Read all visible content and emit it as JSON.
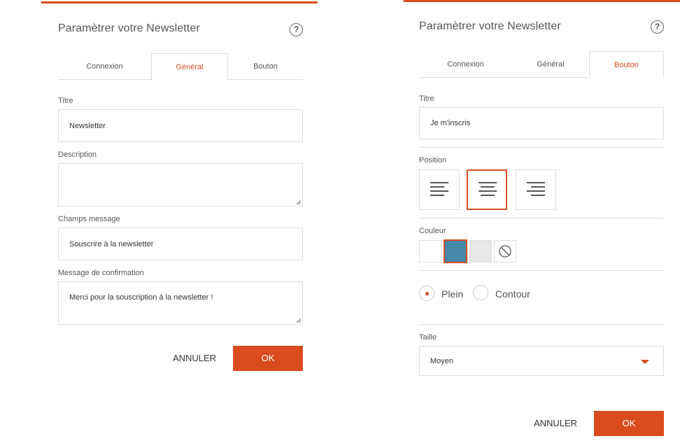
{
  "colors": {
    "accent": "#d94c1e",
    "swatch_white": "#ffffff",
    "swatch_blue": "#4589a8",
    "swatch_grey": "#e8e8e8"
  },
  "left": {
    "title": "Paramètrer votre Newsletter",
    "help": "?",
    "tabs": [
      {
        "label": "Connexion",
        "active": false
      },
      {
        "label": "Général",
        "active": true
      },
      {
        "label": "Bouton",
        "active": false
      }
    ],
    "fields": {
      "titre_label": "Titre",
      "titre_value": "Newsletter",
      "description_label": "Description",
      "description_value": "",
      "champs_label": "Champs message",
      "champs_value": "Souscrire à la newsletter",
      "confirmation_label": "Message de confirmation",
      "confirmation_value": "Merci pour la souscription à la newsletter !"
    },
    "cancel": "ANNULER",
    "ok": "OK"
  },
  "right": {
    "title": "Paramètrer votre Newsletter",
    "help": "?",
    "tabs": [
      {
        "label": "Connexion",
        "active": false
      },
      {
        "label": "Général",
        "active": false
      },
      {
        "label": "Bouton",
        "active": true
      }
    ],
    "titre_label": "Titre",
    "titre_value": "Je m'inscris",
    "position_label": "Position",
    "position_selected": "center",
    "couleur_label": "Couleur",
    "couleur_selected": "blue",
    "style": {
      "plein": "Plein",
      "contour": "Contour",
      "selected": "plein"
    },
    "taille_label": "Taille",
    "taille_value": "Moyen",
    "cancel": "ANNULER",
    "ok": "OK"
  }
}
